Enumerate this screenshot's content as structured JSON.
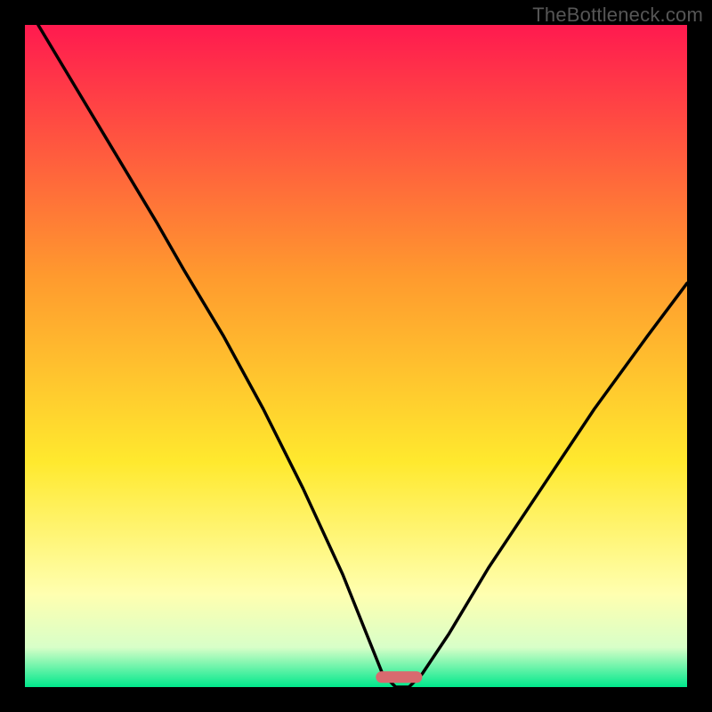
{
  "attribution": "TheBottleneck.com",
  "colors": {
    "gradient_top": "#ff1a4f",
    "gradient_orange": "#ff9a2e",
    "gradient_yellow": "#ffe92e",
    "gradient_paleyellow": "#ffffb0",
    "gradient_green": "#00e88c",
    "curve": "#000000",
    "marker": "#d96a6f",
    "frame": "#000000"
  },
  "chart_data": {
    "type": "line",
    "title": "",
    "xlabel": "",
    "ylabel": "",
    "xlim": [
      0,
      100
    ],
    "ylim": [
      0,
      100
    ],
    "note": "Bottleneck-style V curve; x is configuration axis, y is bottleneck %. Minimum near x≈56.",
    "curve": [
      {
        "x": 2,
        "y": 100
      },
      {
        "x": 8,
        "y": 90
      },
      {
        "x": 14,
        "y": 80
      },
      {
        "x": 20,
        "y": 70
      },
      {
        "x": 24,
        "y": 63
      },
      {
        "x": 30,
        "y": 53
      },
      {
        "x": 36,
        "y": 42
      },
      {
        "x": 42,
        "y": 30
      },
      {
        "x": 48,
        "y": 17
      },
      {
        "x": 52,
        "y": 7
      },
      {
        "x": 54,
        "y": 2
      },
      {
        "x": 56,
        "y": 0
      },
      {
        "x": 58,
        "y": 0
      },
      {
        "x": 60,
        "y": 2
      },
      {
        "x": 64,
        "y": 8
      },
      {
        "x": 70,
        "y": 18
      },
      {
        "x": 78,
        "y": 30
      },
      {
        "x": 86,
        "y": 42
      },
      {
        "x": 94,
        "y": 53
      },
      {
        "x": 100,
        "y": 61
      }
    ],
    "marker": {
      "x_start": 53,
      "x_end": 60,
      "y": 1.5
    }
  }
}
